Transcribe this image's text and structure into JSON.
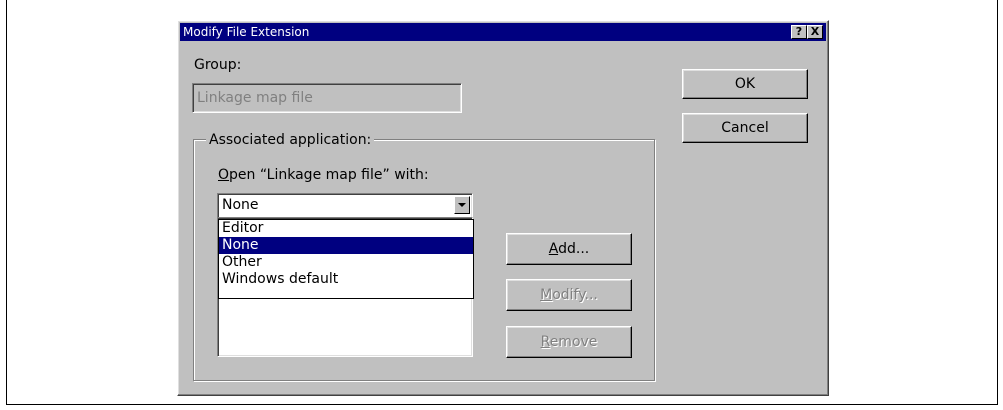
{
  "dialog": {
    "title": "Modify File Extension",
    "help_glyph": "?",
    "close_glyph": "X"
  },
  "group": {
    "label": "Group:",
    "value": "Linkage map file"
  },
  "associated": {
    "legend": "Associated application:",
    "open_with_prefix": "O",
    "open_with_rest": "pen “Linkage map file” with:",
    "combo_value": "None",
    "options": [
      {
        "label": "Editor",
        "selected": false
      },
      {
        "label": "None",
        "selected": true
      },
      {
        "label": "Other",
        "selected": false
      },
      {
        "label": "Windows default",
        "selected": false
      }
    ]
  },
  "buttons": {
    "ok": "OK",
    "cancel": "Cancel",
    "add_mnemonic": "A",
    "add_rest": "dd...",
    "modify_mnemonic": "M",
    "modify_rest": "odify...",
    "remove_mnemonic": "R",
    "remove_rest": "emove"
  },
  "colors": {
    "titlebar": "#000080",
    "face": "#c0c0c0",
    "selection": "#000080"
  }
}
